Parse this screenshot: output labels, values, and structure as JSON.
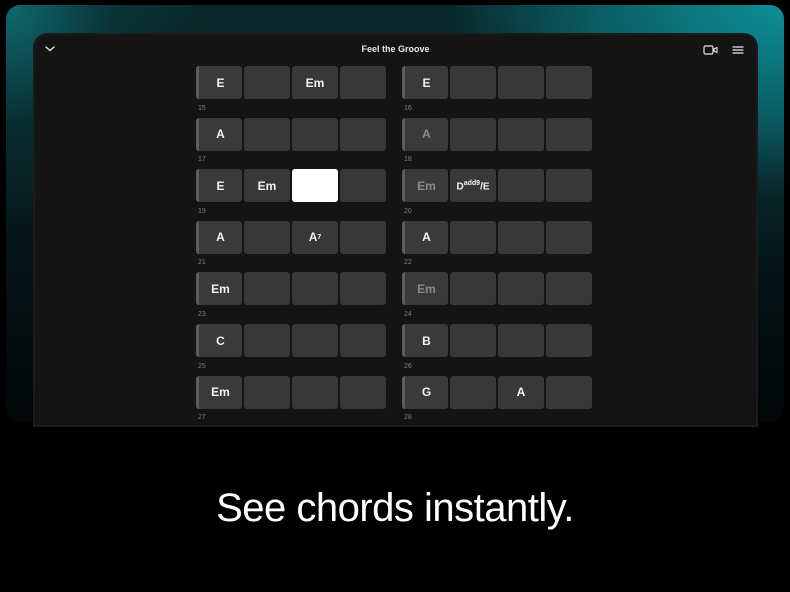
{
  "header": {
    "title": "Feel the Groove"
  },
  "bars": [
    {
      "num": "",
      "chords": [
        "E",
        "",
        "Em",
        ""
      ],
      "dim": [
        false,
        false,
        false,
        false
      ]
    },
    {
      "num": "",
      "chords": [
        "E",
        "",
        "",
        ""
      ],
      "dim": [
        false,
        false,
        false,
        false
      ]
    },
    {
      "num": "15",
      "chords": [
        "A",
        "",
        "",
        ""
      ],
      "dim": [
        false,
        false,
        false,
        false
      ]
    },
    {
      "num": "16",
      "chords": [
        "A",
        "",
        "",
        ""
      ],
      "dim": [
        true,
        false,
        false,
        false
      ]
    },
    {
      "num": "17",
      "chords": [
        "E",
        "Em",
        "",
        ""
      ],
      "dim": [
        false,
        false,
        false,
        false
      ],
      "active": 2
    },
    {
      "num": "18",
      "chords": [
        "Em",
        "Dadd9/E",
        "",
        ""
      ],
      "dim": [
        true,
        false,
        false,
        false
      ]
    },
    {
      "num": "19",
      "chords": [
        "A",
        "",
        "A7",
        ""
      ],
      "dim": [
        false,
        false,
        false,
        false
      ]
    },
    {
      "num": "20",
      "chords": [
        "A",
        "",
        "",
        ""
      ],
      "dim": [
        false,
        false,
        false,
        false
      ]
    },
    {
      "num": "21",
      "chords": [
        "Em",
        "",
        "",
        ""
      ],
      "dim": [
        false,
        false,
        false,
        false
      ]
    },
    {
      "num": "22",
      "chords": [
        "Em",
        "",
        "",
        ""
      ],
      "dim": [
        true,
        false,
        false,
        false
      ]
    },
    {
      "num": "23",
      "chords": [
        "C",
        "",
        "",
        ""
      ],
      "dim": [
        false,
        false,
        false,
        false
      ]
    },
    {
      "num": "24",
      "chords": [
        "B",
        "",
        "",
        ""
      ],
      "dim": [
        false,
        false,
        false,
        false
      ]
    },
    {
      "num": "25",
      "chords": [
        "Em",
        "",
        "",
        ""
      ],
      "dim": [
        false,
        false,
        false,
        false
      ]
    },
    {
      "num": "26",
      "chords": [
        "G",
        "",
        "A",
        ""
      ],
      "dim": [
        false,
        false,
        false,
        false
      ]
    },
    {
      "num": "27",
      "chords": [],
      "dim": []
    },
    {
      "num": "28",
      "chords": [],
      "dim": []
    }
  ],
  "tagline": "See chords instantly."
}
